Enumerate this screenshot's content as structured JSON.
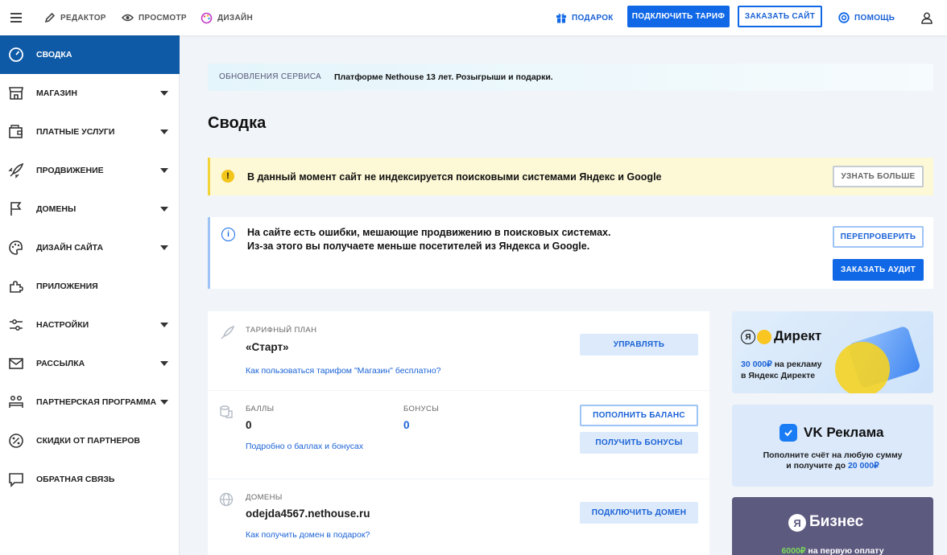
{
  "topbar": {
    "editor": "РЕДАКТОР",
    "preview": "ПРОСМОТР",
    "design": "ДИЗАЙН",
    "gift": "ПОДАРОК",
    "connect_plan": "ПОДКЛЮЧИТЬ ТАРИФ",
    "order_site": "ЗАКАЗАТЬ САЙТ",
    "help": "ПОМОЩЬ"
  },
  "sidebar": {
    "items": [
      {
        "label": "СВОДКА",
        "icon": "gauge-icon",
        "active": true
      },
      {
        "label": "МАГАЗИН",
        "icon": "store-icon",
        "expandable": true
      },
      {
        "label": "ПЛАТНЫЕ УСЛУГИ",
        "icon": "wallet-icon",
        "expandable": true
      },
      {
        "label": "ПРОДВИЖЕНИЕ",
        "icon": "rocket-icon",
        "expandable": true
      },
      {
        "label": "ДОМЕНЫ",
        "icon": "flag-icon",
        "expandable": true
      },
      {
        "label": "ДИЗАЙН САЙТА",
        "icon": "palette-icon",
        "expandable": true
      },
      {
        "label": "ПРИЛОЖЕНИЯ",
        "icon": "puzzle-icon"
      },
      {
        "label": "НАСТРОЙКИ",
        "icon": "sliders-icon",
        "expandable": true
      },
      {
        "label": "РАССЫЛКА",
        "icon": "mail-icon",
        "expandable": true
      },
      {
        "label": "ПАРТНЕРСКАЯ ПРОГРАММА",
        "icon": "partner-icon",
        "expandable": true
      },
      {
        "label": "СКИДКИ ОТ ПАРТНЕРОВ",
        "icon": "percent-icon"
      },
      {
        "label": "ОБРАТНАЯ СВЯЗЬ",
        "icon": "chat-icon"
      }
    ]
  },
  "updates": {
    "label": "ОБНОВЛЕНИЯ СЕРВИСА",
    "text": "Платформе Nethouse 13 лет. Розыгрыши и подарки."
  },
  "page_title": "Сводка",
  "warning": {
    "text": "В данный момент сайт не индексируется поисковыми системами Яндекс и Google",
    "button": "УЗНАТЬ БОЛЬШЕ"
  },
  "info": {
    "line1": "На сайте есть ошибки, мешающие продвижению в поисковых системах.",
    "line2": "Из-за этого вы получаете меньше посетителей из Яндекса и Google.",
    "recheck": "ПЕРЕПРОВЕРИТЬ",
    "order_audit": "ЗАКАЗАТЬ АУДИТ"
  },
  "plan": {
    "caption": "ТАРИФНЫЙ ПЛАН",
    "name": "«Старт»",
    "link": "Как пользоваться тарифом \"Магазин\" бесплатно?",
    "button": "УПРАВЛЯТЬ"
  },
  "points": {
    "caption": "БАЛЛЫ",
    "value": "0",
    "bonus_caption": "БОНУСЫ",
    "bonus_value": "0",
    "link": "Подробно о баллах и бонусах",
    "topup": "ПОПОЛНИТЬ БАЛАНС",
    "get_bonus": "ПОЛУЧИТЬ БОНУСЫ"
  },
  "domains": {
    "caption": "ДОМЕНЫ",
    "value": "odejda4567.nethouse.ru",
    "link": "Как получить домен в подарок?",
    "button": "ПОДКЛЮЧИТЬ ДОМЕН"
  },
  "promos": {
    "direct": {
      "brand": "Директ",
      "amount": "30 000₽",
      "text1": " на рекламу",
      "text2": "в Яндекс Директе"
    },
    "vk": {
      "brand": "VK Реклама",
      "line1": "Пополните счёт на любую сумму",
      "line2_pre": "и получите до ",
      "amount": "20 000₽"
    },
    "business": {
      "brand": "Бизнес",
      "amount": "6000₽",
      "text": " на первую оплату"
    }
  },
  "colors": {
    "accent": "#1068e7",
    "sidebar_active": "#0f5aa6",
    "warning_bg": "#fdf8d6",
    "warning_bar": "#f2d33a",
    "info_bar": "#9ec4f5"
  }
}
